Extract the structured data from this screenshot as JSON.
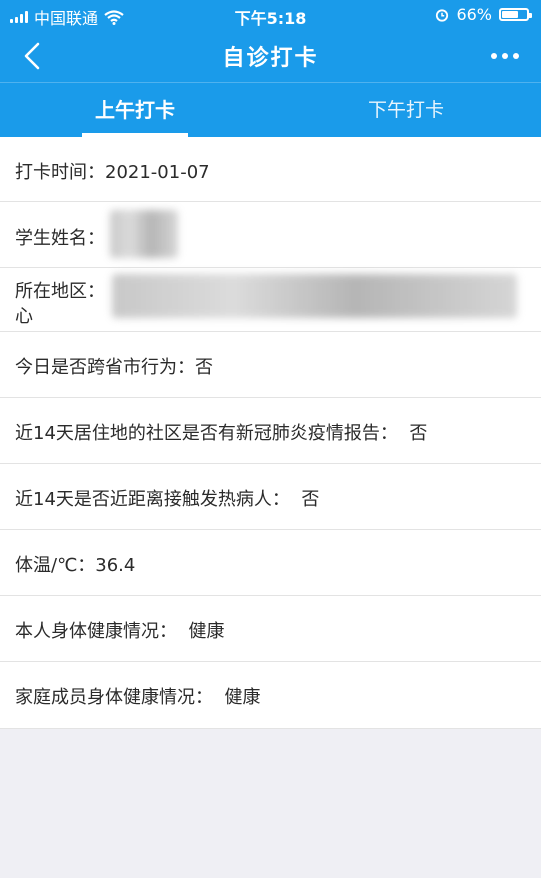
{
  "status_bar": {
    "carrier": "中国联通",
    "time": "下午5:18",
    "battery_percent": "66%",
    "battery_level": 0.66
  },
  "nav": {
    "title": "自诊打卡"
  },
  "tabs": [
    {
      "label": "上午打卡",
      "active": true
    },
    {
      "label": "下午打卡",
      "active": false
    }
  ],
  "records": {
    "checkin_time": {
      "label": "打卡时间：",
      "value": "2021-01-07"
    },
    "student_name": {
      "label": "学生姓名："
    },
    "region": {
      "label": "所在地区：",
      "value_visible_part": "心"
    },
    "cross_province": {
      "label": "今日是否跨省市行为：",
      "value": "否"
    },
    "community_report": {
      "label": "近14天居住地的社区是否有新冠肺炎疫情报告：",
      "value": "否"
    },
    "fever_contact": {
      "label": "近14天是否近距离接触发热病人：",
      "value": "否"
    },
    "temperature": {
      "label": "体温/℃：",
      "value": "36.4"
    },
    "self_health": {
      "label": "本人身体健康情况：",
      "value": "健康"
    },
    "family_health": {
      "label": "家庭成员身体健康情况：",
      "value": "健康"
    }
  },
  "colors": {
    "brand_blue": "#1a9bea",
    "background_gray": "#efeff4"
  }
}
